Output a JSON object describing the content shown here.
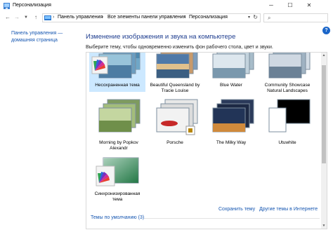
{
  "window": {
    "title": "Персонализация",
    "buttons": {
      "minimize": "─",
      "maximize": "☐",
      "close": "✕"
    }
  },
  "address": {
    "crumbs": [
      "Панель управления",
      "Все элементы панели управления",
      "Персонализация"
    ],
    "separator": "›"
  },
  "sidebar": {
    "home_link": "Панель управления — домашняя страница"
  },
  "main": {
    "heading": "Изменение изображения и звука на компьютере",
    "subtitle": "Выберите тему, чтобы одновременно изменить фон рабочего стола, цвет и звуки."
  },
  "themes": [
    {
      "label": "Несохраненная тема",
      "selected": true
    },
    {
      "label": "Beautiful Queensland by Tracie Louise",
      "selected": false
    },
    {
      "label": "Blue Water",
      "selected": false
    },
    {
      "label": "Community Showcase Natural Landscapes",
      "selected": false
    },
    {
      "label": "Morning by Popkov Alexandr",
      "selected": false
    },
    {
      "label": "Porsche",
      "selected": false
    },
    {
      "label": "The Milky Way",
      "selected": false
    },
    {
      "label": "Utuwhite",
      "selected": false
    },
    {
      "label": "Синхронизированная тема",
      "selected": false
    }
  ],
  "links": {
    "save_theme": "Сохранить тему",
    "more_themes": "Другие темы в Интернете",
    "default_themes": "Темы по умолчанию (3)"
  },
  "colors": {
    "link": "#1556b1",
    "heading": "#1e3d8f",
    "selection": "#cce8ff"
  }
}
